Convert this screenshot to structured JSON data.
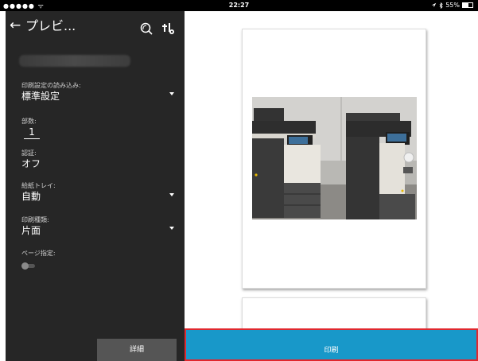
{
  "status_bar": {
    "signal": "●●●●● ᯤ",
    "time": "22:27",
    "battery_text": "55%",
    "battery_level": 0.55
  },
  "sidebar": {
    "title": "プレビ...",
    "account": "",
    "fields": {
      "print_settings": {
        "label": "印刷設定の読み込み:",
        "value": "標準設定"
      },
      "copies": {
        "label": "部数:",
        "value": "1"
      },
      "auth": {
        "label": "認証:",
        "value": "オフ"
      },
      "paper_tray": {
        "label": "給紙トレイ:",
        "value": "自動"
      },
      "print_type": {
        "label": "印刷種類:",
        "value": "片面"
      },
      "page_range": {
        "label": "ページ指定:",
        "enabled": false
      }
    },
    "detail_label": "詳細"
  },
  "preview": {
    "print_label": "印刷"
  },
  "colors": {
    "sidebar_bg": "#262626",
    "print_button": "#1898c9",
    "highlight_border": "#e0282e"
  }
}
